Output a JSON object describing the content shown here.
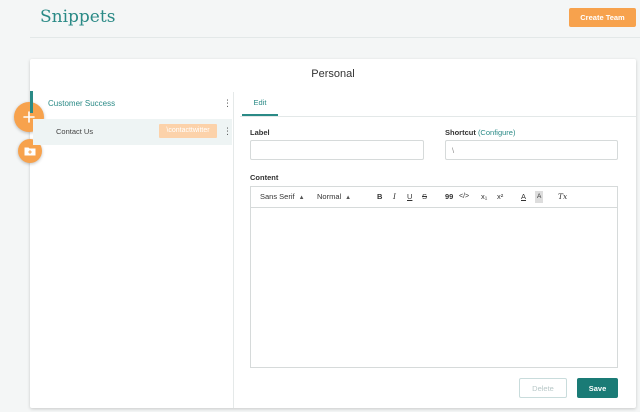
{
  "header": {
    "app_title": "Snippets",
    "create_team_label": "Create Team"
  },
  "panel": {
    "title": "Personal"
  },
  "sidebar": {
    "fab_add_icon": "plus-icon",
    "fab_folder_icon": "folder-add-icon",
    "folder": {
      "label": "Customer Success"
    },
    "snippets": [
      {
        "label": "Contact Us",
        "shortcut": "\\contacttwitter"
      }
    ]
  },
  "editor": {
    "tabs": [
      {
        "label": "Edit"
      }
    ],
    "label_field": {
      "label": "Label",
      "value": "",
      "placeholder": ""
    },
    "shortcut_field": {
      "label": "Shortcut",
      "configure_label": "(Configure)",
      "value": "\\"
    },
    "content_label": "Content",
    "toolbar": {
      "font": "Sans Serif",
      "size": "Normal",
      "bold": "B",
      "italic": "I",
      "underline": "U",
      "strike": "S",
      "blockquote": "99",
      "code": "</>",
      "subscript": "x₁",
      "superscript": "x²",
      "text_color": "A",
      "background_color": "A",
      "clear_format": "Tx"
    },
    "delete_label": "Delete",
    "save_label": "Save"
  },
  "colors": {
    "accent": "#2a8a86",
    "orange": "#f7a24d",
    "save": "#1a7b76"
  }
}
